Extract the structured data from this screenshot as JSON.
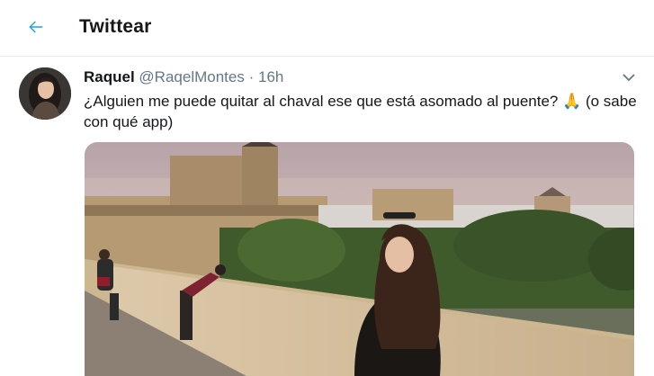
{
  "header": {
    "title": "Twittear",
    "back_icon": "arrow-left-icon",
    "accent": "#1da1f2"
  },
  "tweet": {
    "author_name": "Raquel",
    "handle": "@RaqelMontes",
    "separator": "·",
    "time": "16h",
    "text": "¿Alguien me puede quitar al chaval ese que está asomado al puente? 🙏 (o sabe con qué app)",
    "more_icon": "chevron-down-icon",
    "avatar_icon": "user-avatar",
    "photo_icon": "photo-bridge-cityscape"
  }
}
